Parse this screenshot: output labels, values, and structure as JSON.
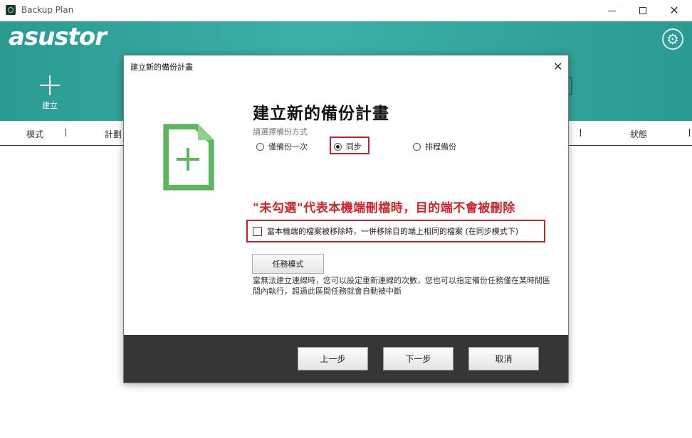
{
  "window": {
    "title": "Backup Plan",
    "minimize_icon": "minimize-icon",
    "maximize_icon": "maximize-icon",
    "close_glyph": "✕"
  },
  "header": {
    "logo": "asustor",
    "create_label": "建立",
    "settings_icon": "gear-icon",
    "accent_color": "#35a89f"
  },
  "columns": {
    "mode": "模式",
    "plan": "計劃",
    "status": "狀態"
  },
  "dialog": {
    "title": "建立新的備份計畫",
    "close_glyph": "✕",
    "heading": "建立新的備份計畫",
    "method_label": "請選擇備份方式",
    "options": [
      {
        "label": "僅備份一次",
        "selected": false
      },
      {
        "label": "同步",
        "selected": true
      },
      {
        "label": "排程備份",
        "selected": false
      }
    ],
    "annotation": "\"未勾選\"代表本機端刪檔時，目的端不會被刪除",
    "checkbox_label": "當本機端的檔案被移除時，一併移除目的端上相同的檔案 (在同步模式下)",
    "checkbox_checked": false,
    "task_mode_label": "任務模式",
    "description": "當無法建立連線時，您可以設定重新連線的次數，您也可以指定備份任務僅在某時間區間內執行，超過此區間任務就會自動被中斷",
    "prev_label": "上一步",
    "next_label": "下一步",
    "cancel_label": "取消",
    "highlight_color": "#c0242a",
    "doc_icon_color": "#5cb85c"
  }
}
